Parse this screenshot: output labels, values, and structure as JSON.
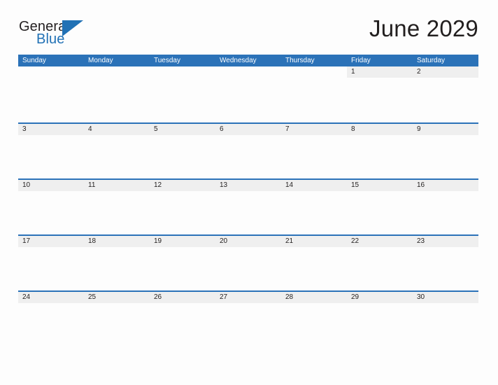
{
  "logo": {
    "text_primary": "General",
    "text_secondary": "Blue",
    "flag_icon": "blue-triangle-flag-icon",
    "color_primary": "#231f20",
    "color_secondary": "#2171b5"
  },
  "title": "June 2029",
  "theme": {
    "header_blue": "#2b72b8",
    "row_divider_blue": "#2b72b8",
    "date_strip_gray": "#efefef",
    "page_background": "#fdfdfd",
    "text_dark": "#221f1f",
    "weekday_text": "#ffffff"
  },
  "weekdays": [
    "Sunday",
    "Monday",
    "Tuesday",
    "Wednesday",
    "Thursday",
    "Friday",
    "Saturday"
  ],
  "weeks": [
    [
      "",
      "",
      "",
      "",
      "",
      "1",
      "2"
    ],
    [
      "3",
      "4",
      "5",
      "6",
      "7",
      "8",
      "9"
    ],
    [
      "10",
      "11",
      "12",
      "13",
      "14",
      "15",
      "16"
    ],
    [
      "17",
      "18",
      "19",
      "20",
      "21",
      "22",
      "23"
    ],
    [
      "24",
      "25",
      "26",
      "27",
      "28",
      "29",
      "30"
    ]
  ]
}
